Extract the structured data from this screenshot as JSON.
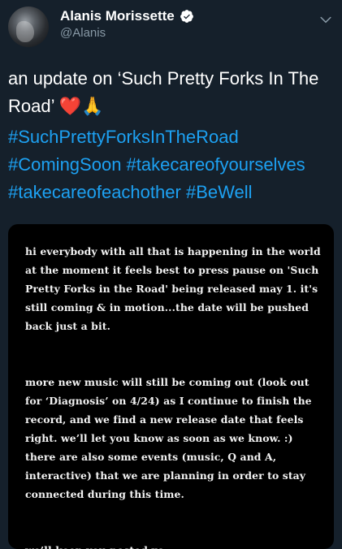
{
  "user": {
    "display_name": "Alanis Morissette",
    "handle": "@Alanis"
  },
  "tweet": {
    "text": "an update on ‘Such Pretty Forks In The Road’ ❤️🙏",
    "hashtags": [
      "#SuchPrettyForksInTheRoad",
      "#ComingSoon",
      "#takecareofyourselves",
      "#takecareofeachother",
      "#BeWell"
    ]
  },
  "media": {
    "paragraphs": [
      "hi everybody with all that is happening in the world at the moment it feels best to press pause on 'Such Pretty Forks in the Road' being released may 1. it's still coming & in motion...the date will be pushed back just a bit.",
      "more new music will still be coming out (look out for ‘Diagnosis’ on 4/24) as I continue to finish the record, and we find a new release date that feels right. we’ll let you know as soon as we know. :) there are also some events (music, Q and A, interactive) that we are planning in order to stay connected during this time.",
      "we’ll keep you posted xo"
    ]
  },
  "colors": {
    "background": "#15202b",
    "link": "#1da1f2",
    "verified": "#ffffff"
  }
}
